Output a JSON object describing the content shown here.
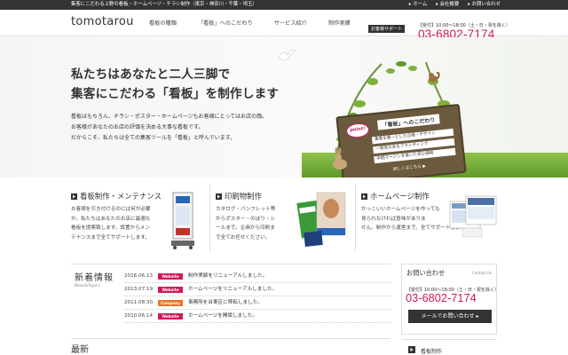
{
  "topbar": {
    "tagline": "集客にこだわる上野の看板・ホームページ・チラシ制作（東京・神奈川・千葉・埼玉）",
    "links": [
      {
        "label": "ホーム"
      },
      {
        "label": "会社概要"
      },
      {
        "label": "お問い合わせ"
      }
    ]
  },
  "header": {
    "logo": "tomotarou",
    "nav": [
      "看板の種類",
      "「看板」へのこだわり",
      "サービス紹介",
      "制作実績"
    ],
    "contact_badge": "お客様サポート",
    "hours": "【受付】10:00～18:00（土・日・祝を除く）",
    "phone": "03-6802-7174"
  },
  "hero": {
    "title_line1": "私たちはあなたと二人三脚で",
    "title_line2": "集客にこだわる「看板」を制作します",
    "body": [
      "看板はもちろん、チラシ・ポスター・ホームページもお客様にとってはお店の顔。",
      "お客様があなたのお店の評価を決める大事な看板です。",
      "だからこそ、私たちは全ての集客ツールを「看板」と呼んでいます。"
    ],
    "sign": {
      "point": "point!",
      "title": "「看板」へのこだわり",
      "items": [
        "集客を第一とした企画・デザイン",
        "一貫性のあるブランディング",
        "中間マージンを省いた安心価格"
      ],
      "more": "詳しくはこちら ▶"
    }
  },
  "services": [
    {
      "title": "看板制作・メンテナンス",
      "lines": [
        "お客様を引き付けるのには何が必要",
        "か。私たちはあなたのお店に最適な",
        "看板を提案致します。設置からメン",
        "テナンスまで全てサポートします。"
      ]
    },
    {
      "title": "印刷物制作",
      "lines": [
        "カタログ・パンフレット等",
        "からポスター・のぼり・シ",
        "ールまで。企画から印刷ま",
        "で全てお任せください。"
      ]
    },
    {
      "title": "ホームページ制作",
      "lines": [
        "かっこいいホームページを作っても",
        "見られなければ意味がありま",
        "せん。制作から運営まで、全てサポートします。"
      ]
    }
  ],
  "news": {
    "title": "新着情報",
    "subtitle": "News&Topics",
    "items": [
      {
        "date": "2016.06.13",
        "badge": "Website",
        "badge_color": "#d0185a",
        "text": "制作実績をリニューアルしました。"
      },
      {
        "date": "2013.07.19",
        "badge": "Website",
        "badge_color": "#d0185a",
        "text": "ホームページをリニューアルしました。"
      },
      {
        "date": "2011.08.30",
        "badge": "Company",
        "badge_color": "#e8742a",
        "text": "事務所を台東区に移転しました。"
      },
      {
        "date": "2010.06.14",
        "badge": "Website",
        "badge_color": "#d0185a",
        "text": "ホームページを開設しました。"
      }
    ]
  },
  "inquiry": {
    "title": "お問い合わせ",
    "subtitle": "Contact Us",
    "hours": "【受付】10:00～18:00（土・日・祝を除く）",
    "phone": "03-6802-7174",
    "button": "メールでお問い合わせ"
  },
  "latest": {
    "title": "最新"
  },
  "side": {
    "item1": "看板制作"
  }
}
